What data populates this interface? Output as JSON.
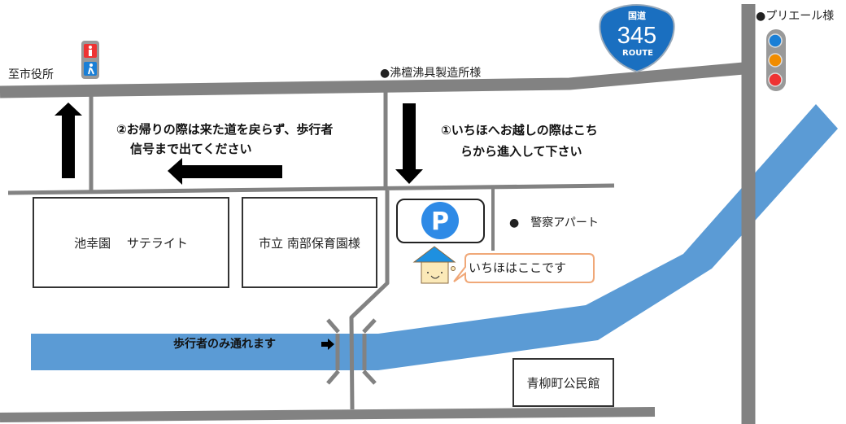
{
  "labels": {
    "city_hall": "至市役所",
    "futsuan": "●沸檀沸具製造所様",
    "purieru": "●プリエール様",
    "police_apartment": "●　警察アパート",
    "instruction_1_line1": "①いちほへお越しの際はこち",
    "instruction_1_line2": "らから進入して下さい",
    "instruction_2_line1": "②お帰りの際は来た道を戻らず、歩行者",
    "instruction_2_line2": "信号まで出てください",
    "pedestrian_only": "歩行者のみ通れます",
    "here": "いちほはここです",
    "parking": "P"
  },
  "buildings": {
    "ikekoen": "池幸園　 サテライト",
    "nanbu_hoikuen": "市立 南部保育園様",
    "community_hall": "青柳町公民館"
  },
  "route_sign": {
    "top": "国道",
    "number": "345",
    "bottom": "ROUTE"
  },
  "icons": [
    "pedestrian-signal-icon",
    "traffic-light-icon",
    "route-sign-icon",
    "parking-icon",
    "house-mascot-icon",
    "arrow-icon"
  ],
  "colors": {
    "road": "#828282",
    "river": "#5b9bd5",
    "route_sign": "#1a6fc0",
    "parking": "#2e8ae6",
    "bubble_border": "#f0a878",
    "house_roof": "#1e90e0",
    "house_wall": "#fbe9b8"
  }
}
